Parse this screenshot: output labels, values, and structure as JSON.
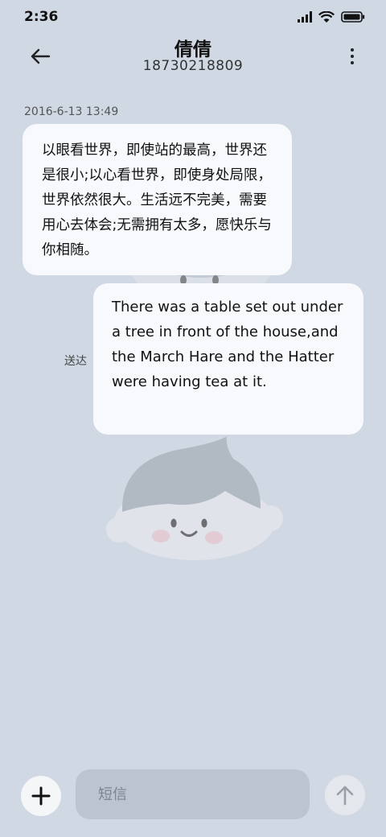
{
  "status_bar": {
    "time": "2:36",
    "icons": [
      "signal-icon",
      "wifi-icon",
      "battery-icon"
    ]
  },
  "header": {
    "contact_name": "倩倩",
    "contact_number": "18730218809",
    "back_icon": "back-arrow-icon",
    "menu_icon": "more-vertical-icon"
  },
  "conversation": {
    "timestamp": "2016-6-13 13:49",
    "messages": [
      {
        "direction": "incoming",
        "text": "以眼看世界，即使站的最高，世界还是很小;以心看世界，即使身处局限，世界依然很大。生活远不完美，需要用心去体会;无需拥有太多，愿快乐与你相随。"
      },
      {
        "direction": "outgoing",
        "status": "送达",
        "text": "There was a table set out under a tree in front of the house,and the March Hare and the Hatter were having tea at it."
      }
    ]
  },
  "composer": {
    "add_icon": "plus-icon",
    "input_placeholder": "短信",
    "input_value": "",
    "send_icon": "send-arrow-up-icon"
  },
  "colors": {
    "background": "#d0d8e4",
    "bubble": "#f7f9fc",
    "input_background": "#bcc4d1"
  }
}
